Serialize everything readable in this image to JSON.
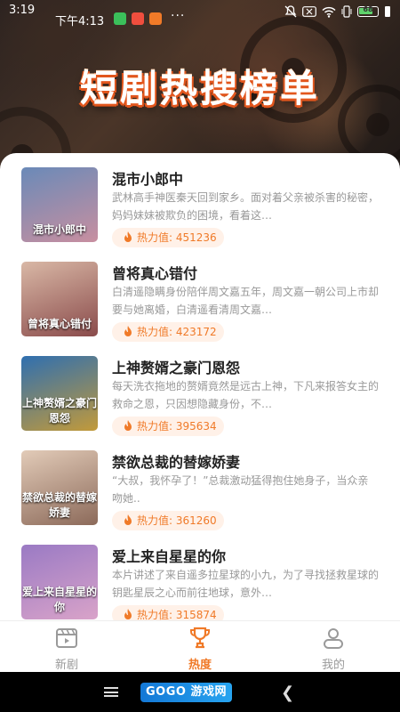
{
  "status_bar": {
    "time_left": "3:19",
    "time_main": "下午4:13",
    "battery_percent": 68,
    "battery_label": "68",
    "more": "···"
  },
  "hero": {
    "title": "短剧热搜榜单"
  },
  "list": [
    {
      "title": "混市小郎中",
      "desc": "武林高手神医秦天回到家乡。面对着父亲被杀害的秘密，妈妈妹妹被欺负的困境，看着这…",
      "heat_label": "热力值: 451236",
      "cover_text": "混市小郎中",
      "cover_colors": [
        "#6a8ab8",
        "#c88fa0"
      ]
    },
    {
      "title": "曾将真心错付",
      "desc": "白清遥隐瞒身份陪伴周文嘉五年，周文嘉一朝公司上市却要与她离婚，白清遥看清周文嘉…",
      "heat_label": "热力值: 423172",
      "cover_text": "曾将真心错付",
      "cover_colors": [
        "#d9b8a6",
        "#8a4b4b"
      ]
    },
    {
      "title": "上神赘婿之豪门恩怨",
      "desc": "每天洗衣拖地的赘婿竟然是远古上神，下凡来报答女主的救命之恩，只因想隐藏身份，不…",
      "heat_label": "热力值: 395634",
      "cover_text": "上神赘婿之豪门恩怨",
      "cover_colors": [
        "#2f6fb0",
        "#c29a3a"
      ]
    },
    {
      "title": "禁欲总裁的替嫁娇妻",
      "desc": "“大叔，我怀孕了！”总裁激动猛得抱住她身子，当众亲吻她..",
      "heat_label": "热力值: 361260",
      "cover_text": "禁欲总裁的替嫁娇妻",
      "cover_colors": [
        "#e2cbb8",
        "#8c6a5a"
      ]
    },
    {
      "title": "爱上来自星星的你",
      "desc": "本片讲述了来自遥多拉星球的小九，为了寻找拯救星球的钥匙星辰之心而前往地球，意外…",
      "heat_label": "热力值: 315874",
      "cover_text": "爱上来自星星的你",
      "cover_colors": [
        "#9a7ac4",
        "#d9a3c9"
      ]
    }
  ],
  "bottom_nav": [
    {
      "label": "新剧",
      "icon": "film-icon",
      "active": false
    },
    {
      "label": "热度",
      "icon": "trophy-icon",
      "active": true
    },
    {
      "label": "我的",
      "icon": "profile-icon",
      "active": false
    }
  ],
  "system_bar": {
    "brand": "GOGO 游戏网"
  },
  "colors": {
    "accent": "#f07a28",
    "heat_bg": "#fff1e8",
    "inactive": "#9a9a9a"
  }
}
